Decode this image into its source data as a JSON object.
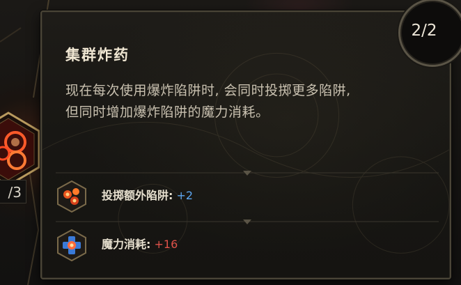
{
  "tooltip": {
    "title": "集群炸药",
    "description_line1": "现在每次使用爆炸陷阱时, 会同时投掷更多陷阱,",
    "description_line2": "但同时增加爆炸陷阱的魔力消耗。",
    "counter": "2/2"
  },
  "stats": [
    {
      "label": "投掷额外陷阱:",
      "value": "+2",
      "icon": "fire-traps-icon",
      "value_color": "#5da6f0"
    },
    {
      "label": "魔力消耗:",
      "value": "+16",
      "icon": "mana-cost-icon",
      "value_color": "#e0524a"
    }
  ],
  "skill_node": {
    "rank": "/3",
    "icon": "explosive-trap-skill-icon"
  }
}
